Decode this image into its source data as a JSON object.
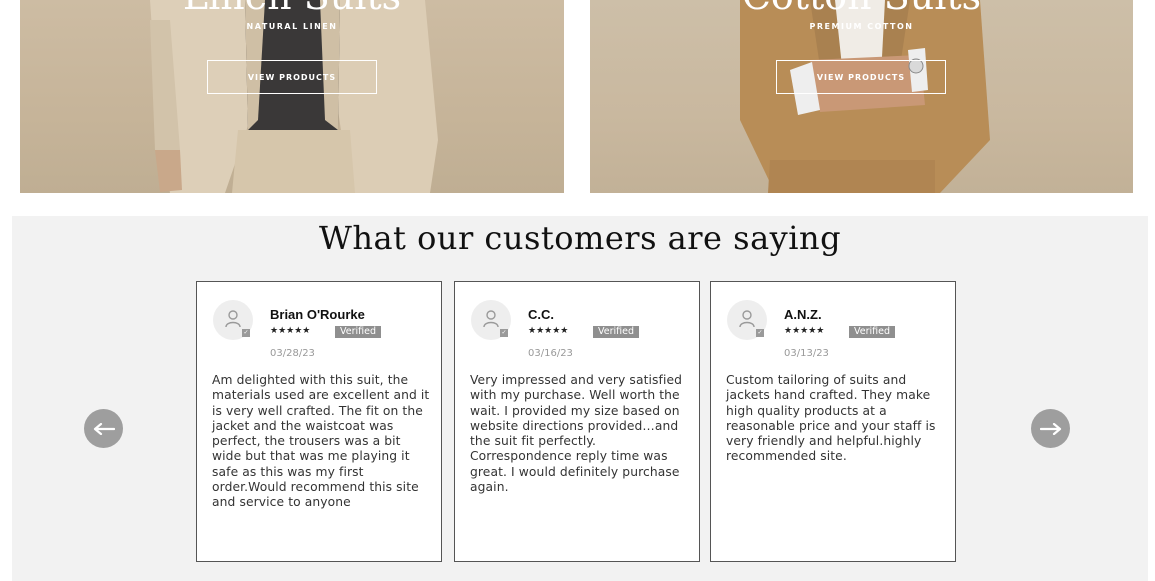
{
  "banners": [
    {
      "title": "Linen Suits",
      "subtitle": "NATURAL LINEN",
      "button": "VIEW PRODUCTS"
    },
    {
      "title": "Cotton Suits",
      "subtitle": "PREMIUM COTTON",
      "button": "VIEW PRODUCTS"
    }
  ],
  "testimonials": {
    "heading": "What our customers are saying",
    "reviews": [
      {
        "name": "Brian O'Rourke",
        "stars": "★★★★★",
        "verified": "Verified",
        "date": "03/28/23",
        "text": "Am delighted with this suit, the materials used are excellent and it is very well crafted. The fit on the jacket and the waistcoat was perfect, the trousers was a bit wide but that was me playing it safe as this was my first order.Would recommend this site and service to anyone"
      },
      {
        "name": "C.C.",
        "stars": "★★★★★",
        "verified": "Verified",
        "date": "03/16/23",
        "text": "Very impressed and very satisfied with my purchase. Well worth the wait. I provided my size based on website directions provided…and the suit fit perfectly. Correspondence reply time was great. I would definitely purchase again."
      },
      {
        "name": "A.N.Z.",
        "stars": "★★★★★",
        "verified": "Verified",
        "date": "03/13/23",
        "text": "Custom tailoring of suits and jackets hand crafted. They make high quality products at a reasonable price and your staff is very friendly and helpful.highly recommended site."
      }
    ]
  },
  "icons": {
    "prev": "arrow-left-icon",
    "next": "arrow-right-icon",
    "avatar": "user-icon"
  },
  "colors": {
    "section_bg": "#f2f2f2",
    "arrow_bg": "#9e9e9e",
    "verified_bg": "#8f8f8f"
  }
}
